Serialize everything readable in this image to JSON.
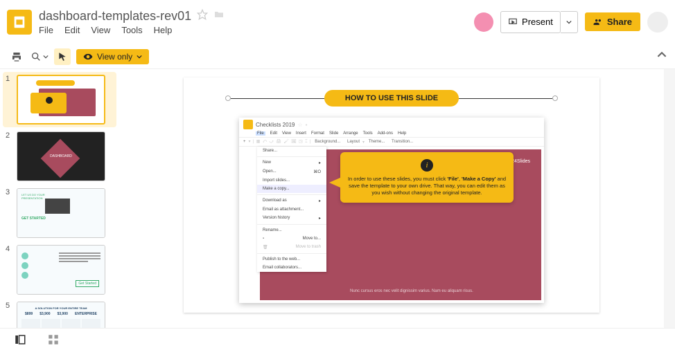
{
  "header": {
    "doc_title": "dashboard-templates-rev01",
    "menu": [
      "File",
      "Edit",
      "View",
      "Tools",
      "Help"
    ],
    "present_label": "Present",
    "share_label": "Share"
  },
  "toolbar": {
    "view_only_label": "View only"
  },
  "filmstrip": {
    "slides": [
      {
        "num": "1"
      },
      {
        "num": "2",
        "title": "DASHBOARD"
      },
      {
        "num": "3",
        "let_us": "LET US DO YOUR",
        "pres": "PRESENTATION",
        "get_started": "GET STARTED"
      },
      {
        "num": "4",
        "get_started_btn": "Get Started"
      },
      {
        "num": "5",
        "header": "A SOLUTION FOR YOUR ENTIRE TEAM",
        "prices": [
          "$899",
          "$3,900",
          "$3,900",
          "ENTERPRISE"
        ]
      }
    ]
  },
  "slide": {
    "title": "HOW TO USE THIS SLIDE",
    "embedded": {
      "doc_title": "Checklists 2019",
      "menus": [
        "File",
        "Edit",
        "View",
        "Insert",
        "Format",
        "Slide",
        "Arrange",
        "Tools",
        "Add-ons",
        "Help"
      ],
      "toolbar_items": [
        "+",
        "Background...",
        "Layout",
        "Theme...",
        "Transition..."
      ],
      "file_menu": {
        "share": "Share...",
        "new": "New",
        "open": "Open...",
        "open_shortcut": "⌘O",
        "import": "Import slides...",
        "make_copy": "Make a copy...",
        "download": "Download as",
        "email_attach": "Email as attachment...",
        "version": "Version history",
        "rename": "Rename...",
        "move": "Move to...",
        "trash": "Move to trash",
        "publish": "Publish to the web...",
        "email_collab": "Email collaborators..."
      },
      "brand": "24Slides"
    },
    "callout": {
      "info_icon": "i",
      "text_parts": {
        "t1": "In order to use these slides, you must click ",
        "b1": "'File'",
        "t2": ", ",
        "b2": "'Make a Copy'",
        "t3": " and save the template to your own drive. That way, you can edit them as you wish without changing the original template."
      }
    },
    "lorem": "Nunc cursus eros nec velit dignissim varius. Nam eu aliquam risus."
  }
}
